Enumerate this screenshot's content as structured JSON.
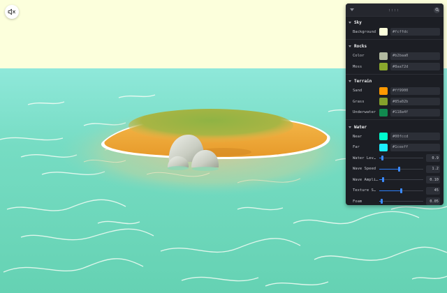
{
  "audio": {
    "icon": "speaker-muted-icon"
  },
  "panel": {
    "icons": {
      "collapse": "caret-down-icon",
      "drag": "grip-dots-icon",
      "search": "search-icon"
    },
    "folders": [
      {
        "title": "Sky",
        "colors": [
          {
            "label": "Background",
            "value": "#fcffdc"
          }
        ]
      },
      {
        "title": "Rocks",
        "colors": [
          {
            "label": "Color",
            "value": "#b2baa0"
          },
          {
            "label": "Moss",
            "value": "#8aa72d"
          }
        ]
      },
      {
        "title": "Terrain",
        "colors": [
          {
            "label": "Sand",
            "value": "#ff9900"
          },
          {
            "label": "Grass",
            "value": "#85a02b"
          },
          {
            "label": "Underwater",
            "value": "#118a4f"
          }
        ]
      },
      {
        "title": "Water",
        "colors": [
          {
            "label": "Near",
            "value": "#00fccd"
          },
          {
            "label": "Far",
            "value": "#1ceeff"
          }
        ],
        "sliders": [
          {
            "label": "Water Lev…",
            "value": "0.9",
            "fraction": 0.07
          },
          {
            "label": "Wave Speed",
            "value": "1.2",
            "fraction": 0.45
          },
          {
            "label": "Wave Ampli…",
            "value": "0.10",
            "fraction": 0.08
          },
          {
            "label": "Texture S…",
            "value": "45",
            "fraction": 0.5
          },
          {
            "label": "Foam",
            "value": "0.05",
            "fraction": 0.05
          }
        ]
      }
    ]
  }
}
